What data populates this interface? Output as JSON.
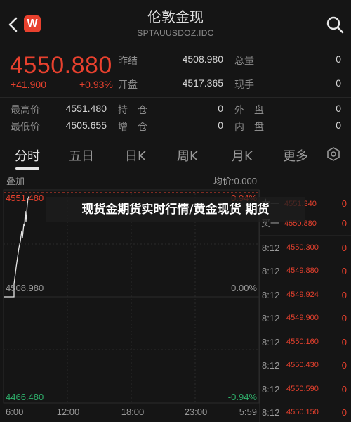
{
  "header": {
    "title": "伦敦金现",
    "subtitle": "SPTAUUSDOZ.IDC",
    "logo_text": "W",
    "back_icon": "chevron-left-icon",
    "search_icon": "search-icon"
  },
  "quote": {
    "price": "4550.880",
    "change": "+41.900",
    "change_pct": "+0.93%",
    "fields": {
      "prev_close_label": "昨结",
      "prev_close": "4508.980",
      "total_volume_label": "总量",
      "total_volume": "0",
      "open_label": "开盘",
      "open": "4517.365",
      "current_hand_label": "现手",
      "current_hand": "0",
      "high_label": "最高价",
      "high": "4551.480",
      "hold_label": "持　仓",
      "hold": "0",
      "outer_label": "外　盘",
      "outer": "0",
      "low_label": "最低价",
      "low": "4505.655",
      "increase_label": "增　仓",
      "increase": "0",
      "inner_label": "内　盘",
      "inner": "0"
    }
  },
  "tabs": [
    {
      "label": "分时",
      "active": true
    },
    {
      "label": "五日",
      "active": false
    },
    {
      "label": "日K",
      "active": false
    },
    {
      "label": "周K",
      "active": false
    },
    {
      "label": "月K",
      "active": false
    },
    {
      "label": "更多",
      "active": false
    }
  ],
  "chart": {
    "overlay_label": "叠加",
    "avg_label": "均价:0.000",
    "y_top": "4551.480",
    "y_top_pct": "0.94%",
    "y_mid": "4508.980",
    "y_mid_pct": "0.00%",
    "y_bottom": "4466.480",
    "y_bottom_pct": "-0.94%",
    "x_ticks": [
      "6:00",
      "12:00",
      "18:00",
      "23:00",
      "5:59"
    ],
    "colors": {
      "line": "#e6e6e6",
      "up": "#e8412e",
      "down": "#2fb36d",
      "grid": "#2a2a2a"
    }
  },
  "order_book": {
    "sell_label": "卖一",
    "sell_price": "4551.340",
    "sell_vol": "0",
    "buy_label": "买一",
    "buy_price": "4550.880",
    "buy_vol": "0"
  },
  "trades": [
    {
      "time": "8:12",
      "price": "4550.300",
      "vol": "0"
    },
    {
      "time": "8:12",
      "price": "4549.880",
      "vol": "0"
    },
    {
      "time": "8:12",
      "price": "4549.924",
      "vol": "0"
    },
    {
      "time": "8:12",
      "price": "4549.900",
      "vol": "0"
    },
    {
      "time": "8:12",
      "price": "4550.160",
      "vol": "0"
    },
    {
      "time": "8:12",
      "price": "4550.430",
      "vol": "0"
    },
    {
      "time": "8:12",
      "price": "4550.590",
      "vol": "0"
    },
    {
      "time": "8:12",
      "price": "4550.150",
      "vol": "0"
    }
  ],
  "banner": {
    "text": "现货金期货实时行情/黄金现货 期货"
  }
}
